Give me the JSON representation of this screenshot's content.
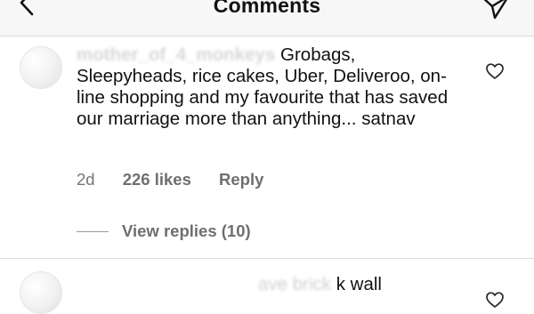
{
  "header": {
    "title": "Comments",
    "back_icon": "chevron-left-icon",
    "send_icon": "paper-plane-icon"
  },
  "comments": [
    {
      "username": "mother_of_4_monkeys",
      "text": "Grobags, Sleepyheads, rice cakes, Uber, Deliveroo, on-line shopping and my favourite that has saved our marriage more than anything... satnav",
      "time": "2d",
      "likes": "226 likes",
      "reply_label": "Reply",
      "view_replies": "View replies (10)",
      "like_icon": "heart-outline-icon"
    },
    {
      "username": "the_one_who_hit",
      "text": "a brick wall",
      "like_icon": "heart-outline-icon"
    }
  ],
  "colors": {
    "header_bg": "#f7f7f7",
    "text": "#111111",
    "meta": "#737373"
  }
}
